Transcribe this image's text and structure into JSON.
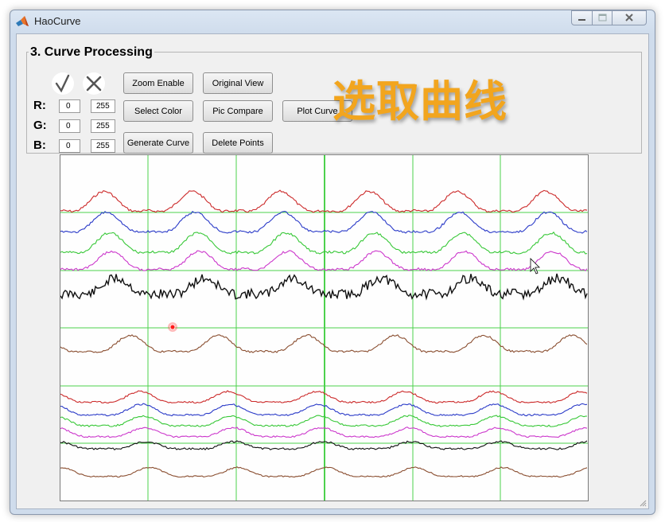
{
  "window": {
    "title": "HaoCurve"
  },
  "panel": {
    "title": "3. Curve Processing"
  },
  "rgb": {
    "r": {
      "label": "R:",
      "min": "0",
      "max": "255"
    },
    "g": {
      "label": "G:",
      "min": "0",
      "max": "255"
    },
    "b": {
      "label": "B:",
      "min": "0",
      "max": "255"
    }
  },
  "buttons": {
    "zoom_enable": "Zoom Enable",
    "original_view": "Original View",
    "select_color": "Select Color",
    "pic_compare": "Pic Compare",
    "plot_curve": "Plot Curve",
    "generate_curve": "Generate Curve",
    "delete_points": "Delete Points"
  },
  "overlay": {
    "caption": "选取曲线"
  },
  "icons": {
    "confirm": "check-icon",
    "cancel": "cross-icon",
    "app": "matlab-icon"
  },
  "colors": {
    "overlay": "#f2a51e",
    "grid": "#4cd14c",
    "curves": [
      "#cc2a2a",
      "#2a3ac8",
      "#38c838",
      "#cc38cc",
      "#111111",
      "#8a4e30",
      "#cc2a2a",
      "#2a3ac8",
      "#38c838",
      "#cc38cc",
      "#111111",
      "#8a4e30"
    ]
  }
}
